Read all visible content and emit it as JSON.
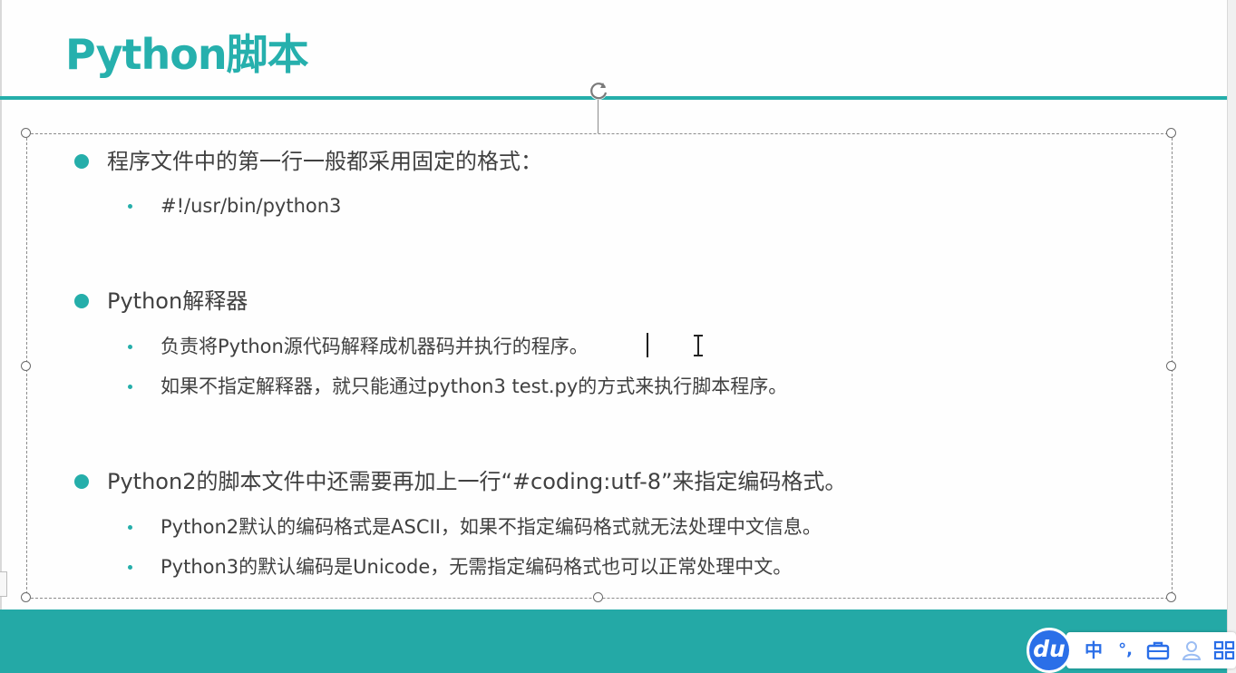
{
  "slide": {
    "title": "Python脚本",
    "colors": {
      "accent": "#25aeaa",
      "text": "#404040",
      "footer": "#24a9a6",
      "ime_blue": "#2b6fe8"
    },
    "bullets": [
      {
        "text": "程序文件中的第一行一般都采用固定的格式：",
        "sub": [
          "#!/usr/bin/python3"
        ]
      },
      {
        "text": "Python解释器",
        "sub": [
          "负责将Python源代码解释成机器码并执行的程序。",
          "如果不指定解释器，就只能通过python3 test.py的方式来执行脚本程序。"
        ]
      },
      {
        "text": "Python2的脚本文件中还需要再加上一行“#coding:utf-8”来指定编码格式。",
        "sub": [
          "Python2默认的编码格式是ASCII，如果不指定编码格式就无法处理中文信息。",
          "Python3的默认编码是Unicode，无需指定编码格式也可以正常处理中文。"
        ]
      }
    ]
  },
  "ime": {
    "logo": "du",
    "mode": "中",
    "punct": "°,",
    "icons": [
      "toolbox-icon",
      "user-icon",
      "grid-icon"
    ]
  }
}
